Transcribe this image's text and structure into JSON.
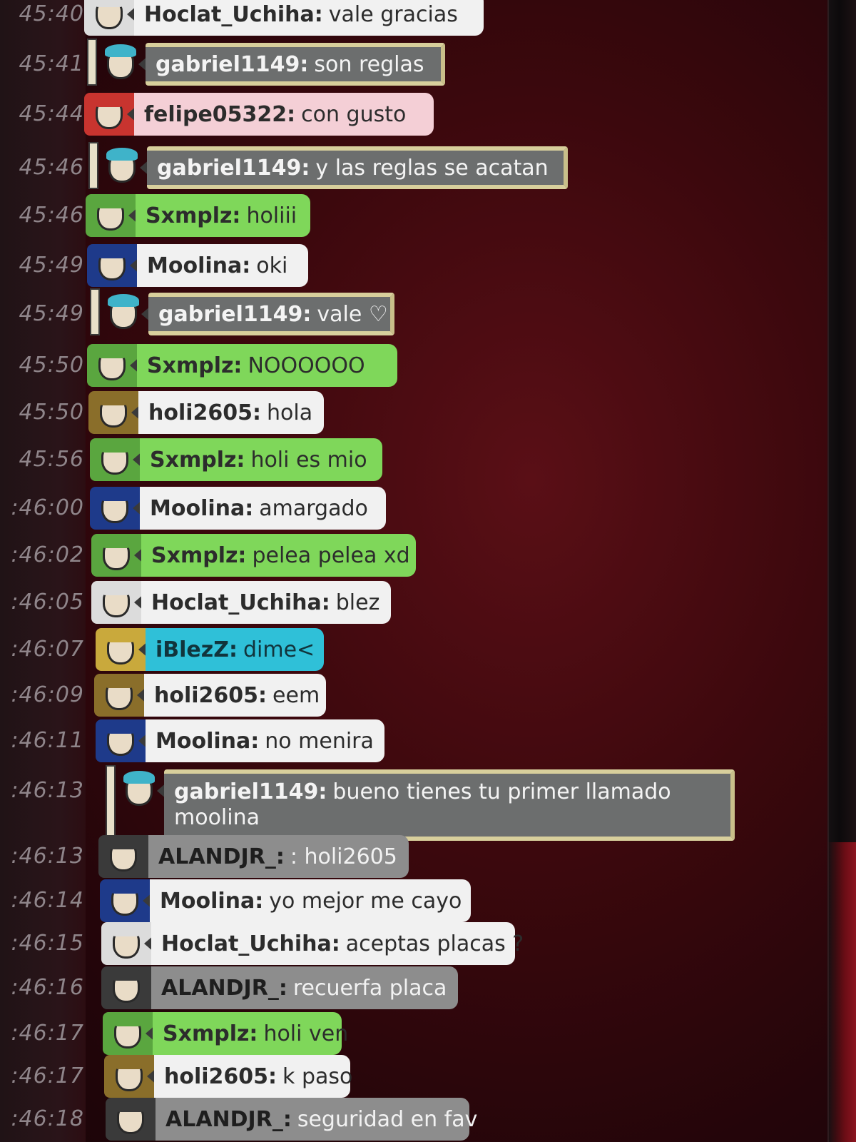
{
  "chat": {
    "messages": [
      {
        "time": "45:40",
        "user": "Hoclat_Uchiha:",
        "text": "vale gracias",
        "style": "white",
        "avatar_color": "#dcdcdc"
      },
      {
        "time": "45:41",
        "user": "gabriel1149:",
        "text": "son reglas",
        "style": "mod",
        "avatar_color": "#3fb3c9"
      },
      {
        "time": "45:44",
        "user": "felipe05322:",
        "text": "con gusto",
        "style": "pink",
        "avatar_color": "#c8342f"
      },
      {
        "time": "45:46",
        "user": "gabriel1149:",
        "text": "y las reglas se acatan",
        "style": "mod",
        "avatar_color": "#3fb3c9"
      },
      {
        "time": "45:46",
        "user": "Sxmplz:",
        "text": "holiii",
        "style": "green",
        "avatar_color": "#5aa63f"
      },
      {
        "time": "45:49",
        "user": "Moolina:",
        "text": "oki",
        "style": "white",
        "avatar_color": "#1e3a8a"
      },
      {
        "time": "45:49",
        "user": "gabriel1149:",
        "text": "vale ♡",
        "style": "mod",
        "avatar_color": "#3fb3c9"
      },
      {
        "time": "45:50",
        "user": "Sxmplz:",
        "text": "NOOOOOO",
        "style": "green",
        "avatar_color": "#5aa63f"
      },
      {
        "time": "45:50",
        "user": "holi2605:",
        "text": "hola",
        "style": "white",
        "avatar_color": "#8a6e2a"
      },
      {
        "time": "45:56",
        "user": "Sxmplz:",
        "text": "holi es mio",
        "style": "green",
        "avatar_color": "#5aa63f"
      },
      {
        "time": ":46:00",
        "user": "Moolina:",
        "text": "amargado",
        "style": "white",
        "avatar_color": "#1e3a8a"
      },
      {
        "time": ":46:02",
        "user": "Sxmplz:",
        "text": "pelea pelea xd",
        "style": "green",
        "avatar_color": "#5aa63f"
      },
      {
        "time": ":46:05",
        "user": "Hoclat_Uchiha:",
        "text": "blez",
        "style": "white",
        "avatar_color": "#dcdcdc"
      },
      {
        "time": ":46:07",
        "user": "iBlezZ:",
        "text": "dime<",
        "style": "cyan",
        "avatar_color": "#c9a93c"
      },
      {
        "time": ":46:09",
        "user": "holi2605:",
        "text": "eem",
        "style": "white",
        "avatar_color": "#8a6e2a"
      },
      {
        "time": ":46:11",
        "user": "Moolina:",
        "text": "no menira",
        "style": "white",
        "avatar_color": "#1e3a8a"
      },
      {
        "time": ":46:13",
        "user": "gabriel1149:",
        "text": "bueno tienes tu primer llamado",
        "text2": "moolina",
        "style": "mod",
        "avatar_color": "#3fb3c9"
      },
      {
        "time": ":46:13",
        "user": "ALANDJR_:",
        "text": ": holi2605",
        "style": "gray",
        "avatar_color": "#3a3a3a"
      },
      {
        "time": ":46:14",
        "user": "Moolina:",
        "text": "yo mejor me cayo",
        "style": "white",
        "avatar_color": "#1e3a8a"
      },
      {
        "time": ":46:15",
        "user": "Hoclat_Uchiha:",
        "text": "aceptas placas ?",
        "style": "white",
        "avatar_color": "#dcdcdc"
      },
      {
        "time": ":46:16",
        "user": "ALANDJR_:",
        "text": "recuerfa placa",
        "style": "gray",
        "avatar_color": "#3a3a3a"
      },
      {
        "time": ":46:17",
        "user": "Sxmplz:",
        "text": "holi ven",
        "style": "green",
        "avatar_color": "#5aa63f"
      },
      {
        "time": ":46:17",
        "user": "holi2605:",
        "text": "k paso",
        "style": "white",
        "avatar_color": "#8a6e2a"
      },
      {
        "time": ":46:18",
        "user": "ALANDJR_:",
        "text": "seguridad en fav",
        "style": "gray",
        "avatar_color": "#3a3a3a"
      }
    ]
  },
  "timestamps_display": [
    "45:40",
    "45:41",
    "45:44",
    "45:46",
    "45:46",
    "45:49",
    "45:49",
    "45:50",
    "45:50",
    "45:56",
    "46:00",
    "46:02",
    "46:05",
    "46:07",
    "46:09",
    "46:11",
    "46:13",
    "46:13",
    "46:14",
    "46:15",
    "46:16",
    "46:17",
    "46:17",
    "46:18"
  ]
}
